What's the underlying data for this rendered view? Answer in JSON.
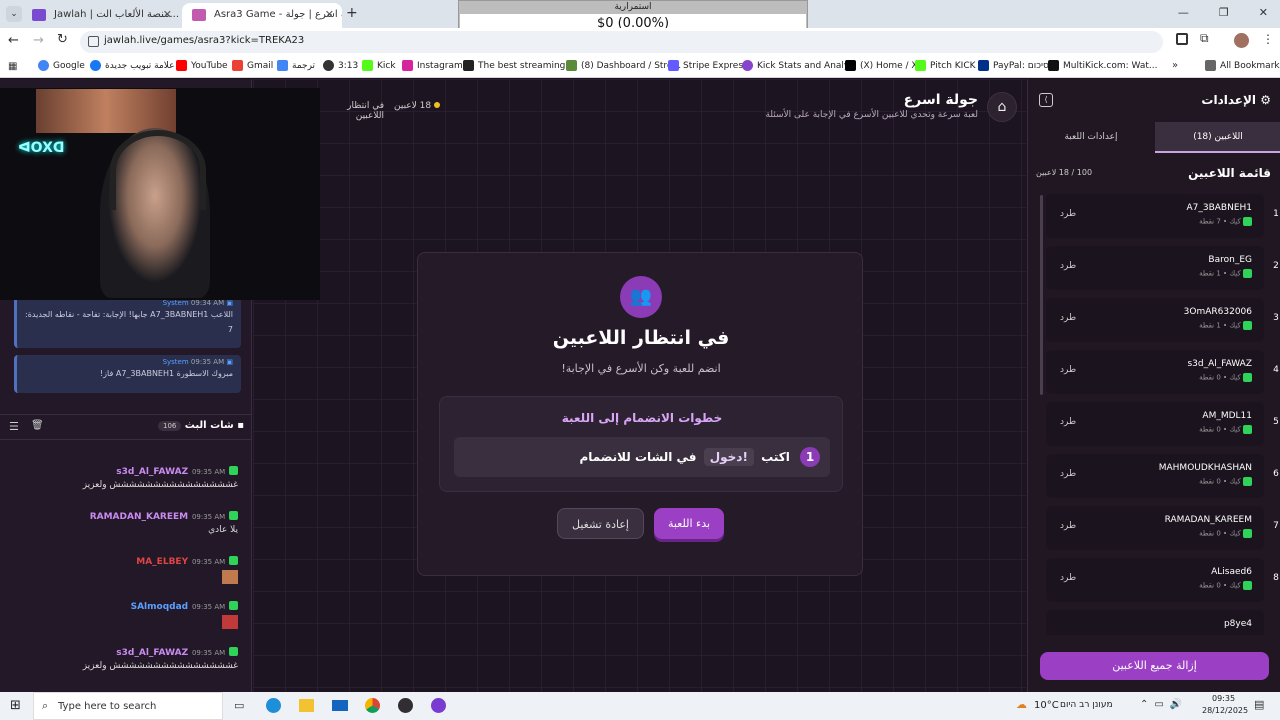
{
  "browser": {
    "tabs": [
      {
        "label": "Jawlah | منصة الألعاب الت..."
      },
      {
        "label": "Asra3 Game - جولة اسرع | جولة"
      }
    ],
    "new_tab": "+",
    "url": "jawlah.live/games/asra3?kick=TREKA23",
    "overlay_title": "استمرارية",
    "overlay_value": "$0 (0.00%)",
    "bookmarks": [
      "Google",
      "علامة تبويب جديدة",
      "YouTube",
      "Gmail",
      "ترجمة",
      "3:13",
      "Kick",
      "Instagram",
      "The best streaming...",
      "(8) Dashboard / Stre...",
      "Stripe Express",
      "Kick Stats and Analy...",
      "(X) Home / X",
      "Pitch KICK",
      "PayPal: סיכום",
      "MultiKick.com: Wat...",
      "All Bookmarks"
    ]
  },
  "header": {
    "title": "جولة اسرع",
    "subtitle": "لعبة سرعة وتحدي للاعبين الأسرع في الإجابة على الأسئلة",
    "status": "في انتظار اللاعبين",
    "count": "18 لاعبين"
  },
  "waiting": {
    "title": "في انتظار اللاعبين",
    "subtitle": "انضم للعبة وكن الأسرع في الإجابة!",
    "steps_title": "خطوات الانضمام إلى اللعبة",
    "step_number": "1",
    "step_text_1": "اكتب",
    "step_command": "!دخول",
    "step_text_2": "في الشات للانضمام",
    "start_button": "بدء اللعبة",
    "restart_button": "إعادة تشغيل"
  },
  "settings": {
    "title": "الإعدادات",
    "tab_players": "اللاعبين (18)",
    "tab_game": "إعدادات اللعبة",
    "list_title": "قائمة اللاعبين",
    "list_count": "100 / 18 لاعبين",
    "kick_label": "طرد",
    "remove_all": "إزالة جميع اللاعبين",
    "players": [
      {
        "rank": "1",
        "name": "A7_3BABNEH1",
        "meta": "كيك • 7 نقطة"
      },
      {
        "rank": "2",
        "name": "Baron_EG",
        "meta": "كيك • 1 نقطة"
      },
      {
        "rank": "3",
        "name": "3OmAR632006",
        "meta": "كيك • 1 نقطة"
      },
      {
        "rank": "4",
        "name": "s3d_Al_FAWAZ",
        "meta": "كيك • 0 نقطة"
      },
      {
        "rank": "5",
        "name": "AM_MDL11",
        "meta": "كيك • 0 نقطة"
      },
      {
        "rank": "6",
        "name": "MAHMOUDKHASHAN",
        "meta": "كيك • 0 نقطة"
      },
      {
        "rank": "7",
        "name": "RAMADAN_KAREEM",
        "meta": "كيك • 0 نقطة"
      },
      {
        "rank": "8",
        "name": "ALisaed6",
        "meta": "كيك • 0 نقطة"
      },
      {
        "rank": "",
        "name": "p8ye4",
        "meta": ""
      }
    ]
  },
  "system_msgs": [
    {
      "sender": "System",
      "time": "09:34 AM",
      "text": "اللاعب A7_3BABNEH1 جابها! الإجابة: تفاحة - نقاطه الجديدة: 7"
    },
    {
      "sender": "System",
      "time": "09:35 AM",
      "text": "مبروك الاسطورة A7_3BABNEH1 فاز!"
    }
  ],
  "chat": {
    "title": "شات البث",
    "count": "106",
    "messages": [
      {
        "user": "s3d_Al_FAWAZ",
        "time": "09:35 AM",
        "text": "غششششششششششششششش ولعزيز",
        "color": "#c98bf0"
      },
      {
        "user": "RAMADAN_KAREEM",
        "time": "09:35 AM",
        "text": "يلا عادي",
        "color": "#c98bf0"
      },
      {
        "user": "MA_ELBEY",
        "time": "09:35 AM",
        "text": "",
        "color": "#e04545"
      },
      {
        "user": "SAlmoqdad",
        "time": "09:35 AM",
        "text": "",
        "color": "#5aa0ff"
      },
      {
        "user": "s3d_Al_FAWAZ",
        "time": "09:35 AM",
        "text": "غششششششششششششششش ولعزيز",
        "color": "#c98bf0"
      }
    ]
  },
  "taskbar": {
    "search": "Type here to search",
    "weather": "10°C",
    "weather_text": "מעונן רב היום",
    "time": "09:35",
    "date": "28/12/2025"
  },
  "colors": {
    "accent": "#9b3fc4",
    "panel": "#201722",
    "green": "#2fd35a"
  }
}
